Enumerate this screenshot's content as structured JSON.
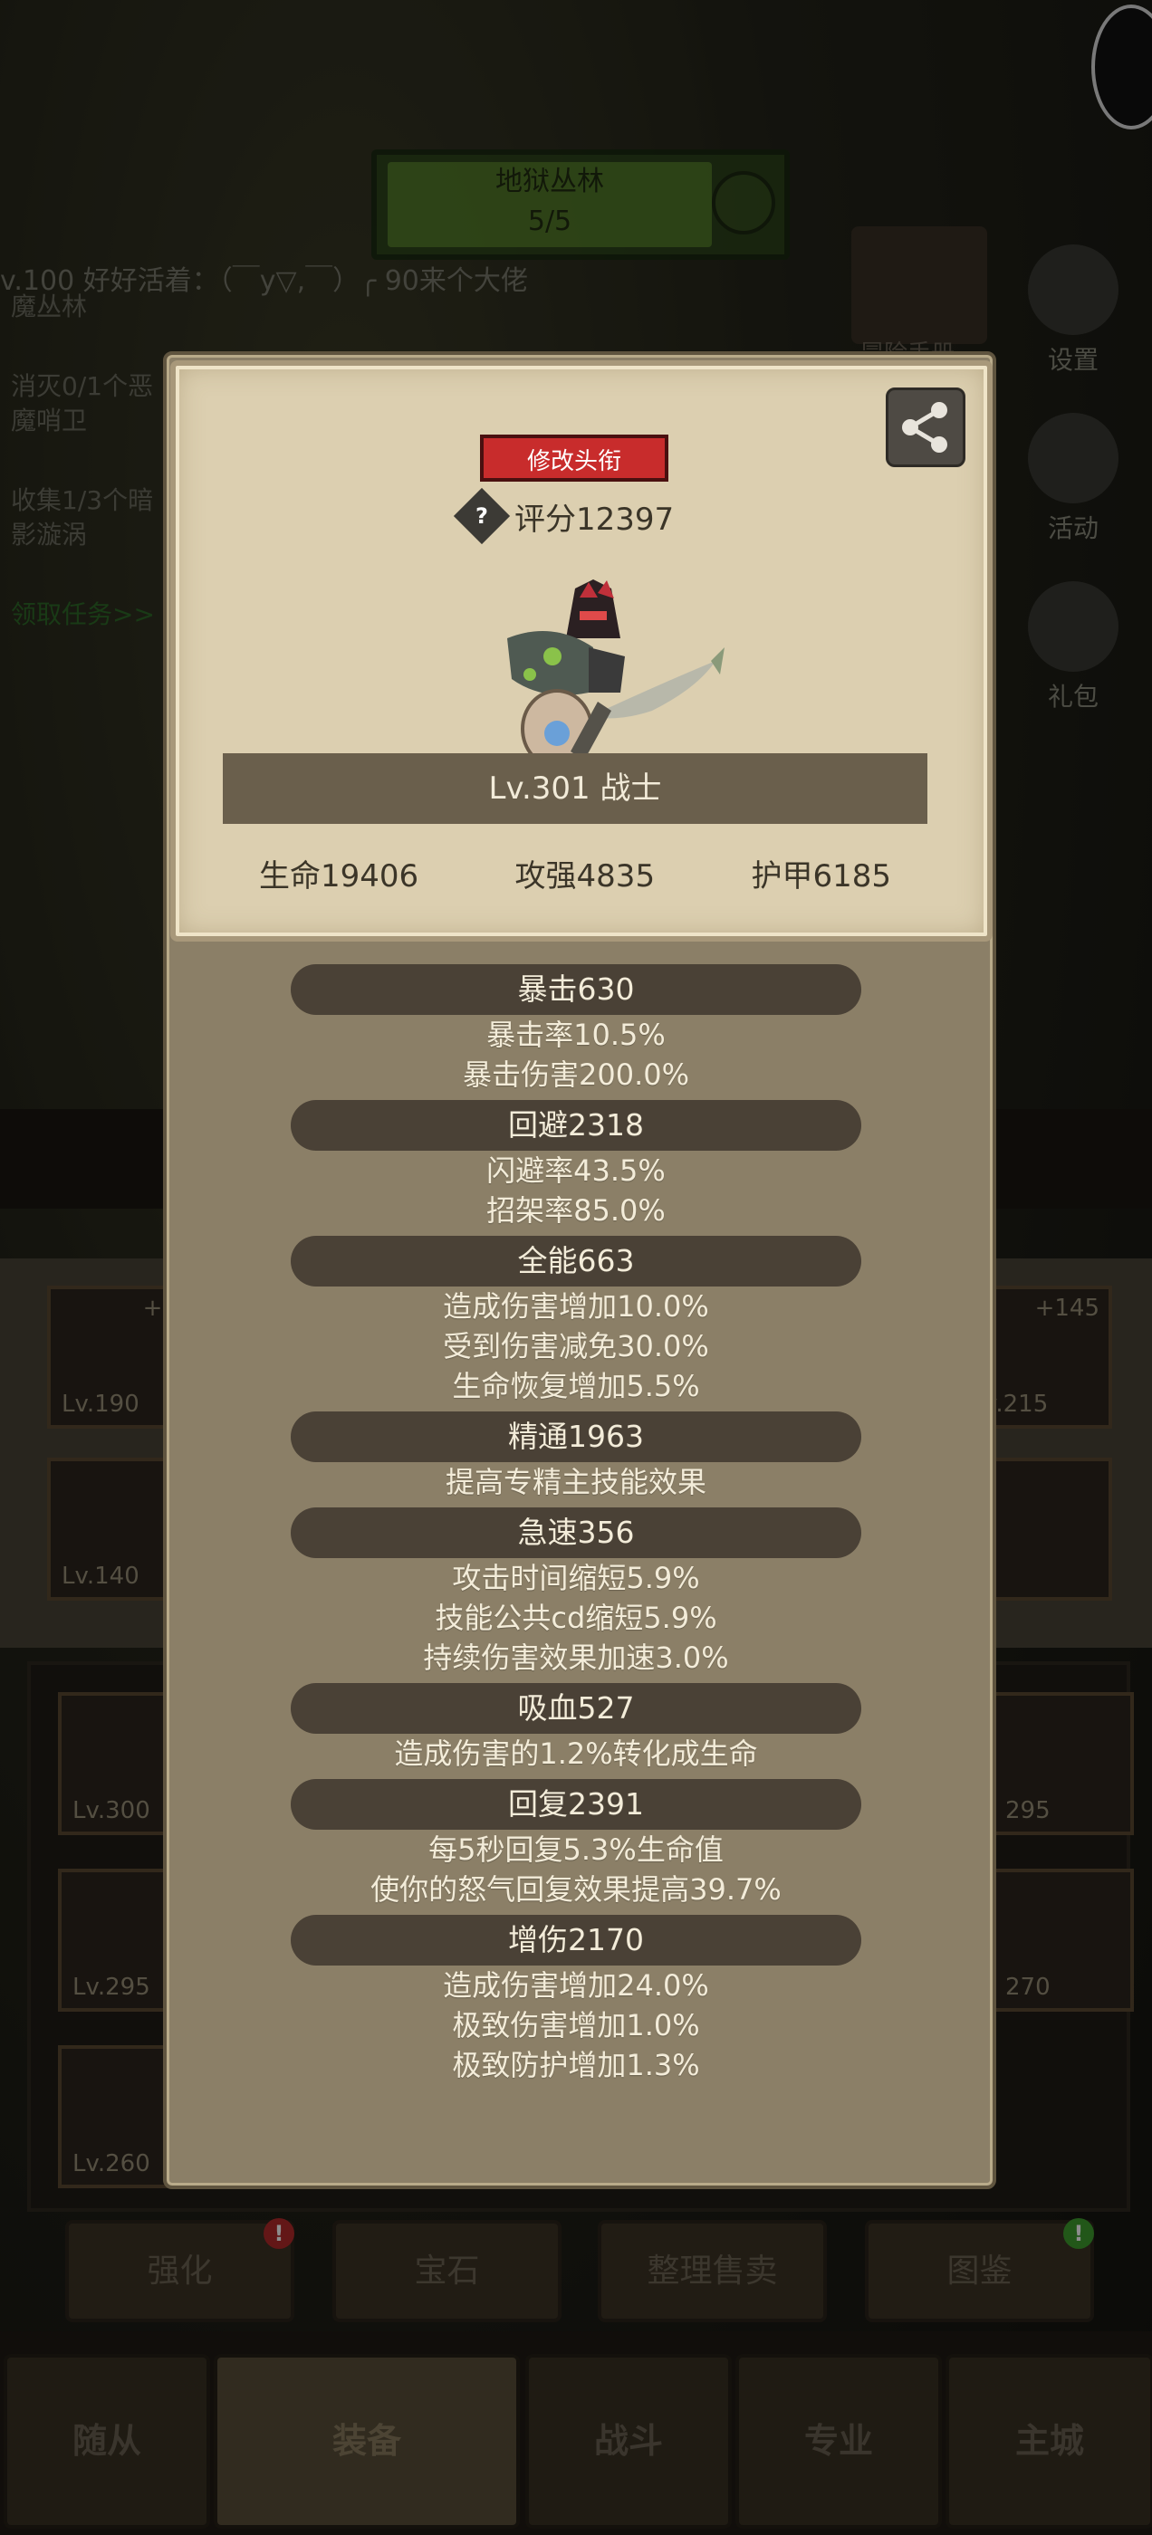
{
  "background": {
    "stage": {
      "name": "地狱丛林",
      "progress": "5/5"
    },
    "chat_text": "v.100 好好活着：（￣y▽,￣）╭ 90来个大佬",
    "quests": [
      {
        "text": "魔丛林"
      },
      {
        "text": "消灭0/1个恶魔哨卫"
      },
      {
        "text": "收集1/3个暗影漩涡"
      }
    ],
    "claim_quest": "领取任务>>",
    "adventure_label": "冒险手册",
    "right_menu": [
      {
        "label": "设置",
        "icon": "gear-icon"
      },
      {
        "label": "活动",
        "icon": "scroll-icon"
      },
      {
        "label": "礼包",
        "icon": "gift-icon"
      }
    ],
    "equip_slots": [
      {
        "level": "Lv.190",
        "plus": "+1"
      },
      {
        "level": "Lv.140",
        "plus": ""
      },
      {
        "level": "v.215",
        "plus": "+145"
      }
    ],
    "inventory_levels": [
      "Lv.300",
      "Lv.295",
      "Lv.260",
      "295",
      "270"
    ],
    "action_buttons": [
      {
        "label": "强化",
        "badge": "!"
      },
      {
        "label": "宝石",
        "badge": ""
      },
      {
        "label": "整理售卖",
        "badge": ""
      },
      {
        "label": "图鉴",
        "badge": "!"
      }
    ],
    "tabs": [
      {
        "label": "随从"
      },
      {
        "label": "装备"
      },
      {
        "label": "战斗"
      },
      {
        "label": "专业"
      },
      {
        "label": "主城"
      }
    ]
  },
  "profile": {
    "rename_title_label": "修改头衔",
    "score": "评分12397",
    "name_line": "Lv.301 战士",
    "hp": "生命19406",
    "attack": "攻强4835",
    "armor": "护甲6185"
  },
  "attributes": [
    {
      "header": "暴击630",
      "lines": [
        "暴击率10.5%",
        "暴击伤害200.0%"
      ]
    },
    {
      "header": "回避2318",
      "lines": [
        "闪避率43.5%",
        "招架率85.0%"
      ]
    },
    {
      "header": "全能663",
      "lines": [
        "造成伤害增加10.0%",
        "受到伤害减免30.0%",
        "生命恢复增加5.5%"
      ]
    },
    {
      "header": "精通1963",
      "lines": [
        "提高专精主技能效果"
      ]
    },
    {
      "header": "急速356",
      "lines": [
        "攻击时间缩短5.9%",
        "技能公共cd缩短5.9%",
        "持续伤害效果加速3.0%"
      ]
    },
    {
      "header": "吸血527",
      "lines": [
        "造成伤害的1.2%转化成生命"
      ]
    },
    {
      "header": "回复2391",
      "lines": [
        "每5秒回复5.3%生命值",
        "使你的怒气回复效果提高39.7%"
      ]
    },
    {
      "header": "增伤2170",
      "lines": [
        "造成伤害增加24.0%",
        "极致伤害增加1.0%",
        "极致防护增加1.3%"
      ]
    }
  ]
}
